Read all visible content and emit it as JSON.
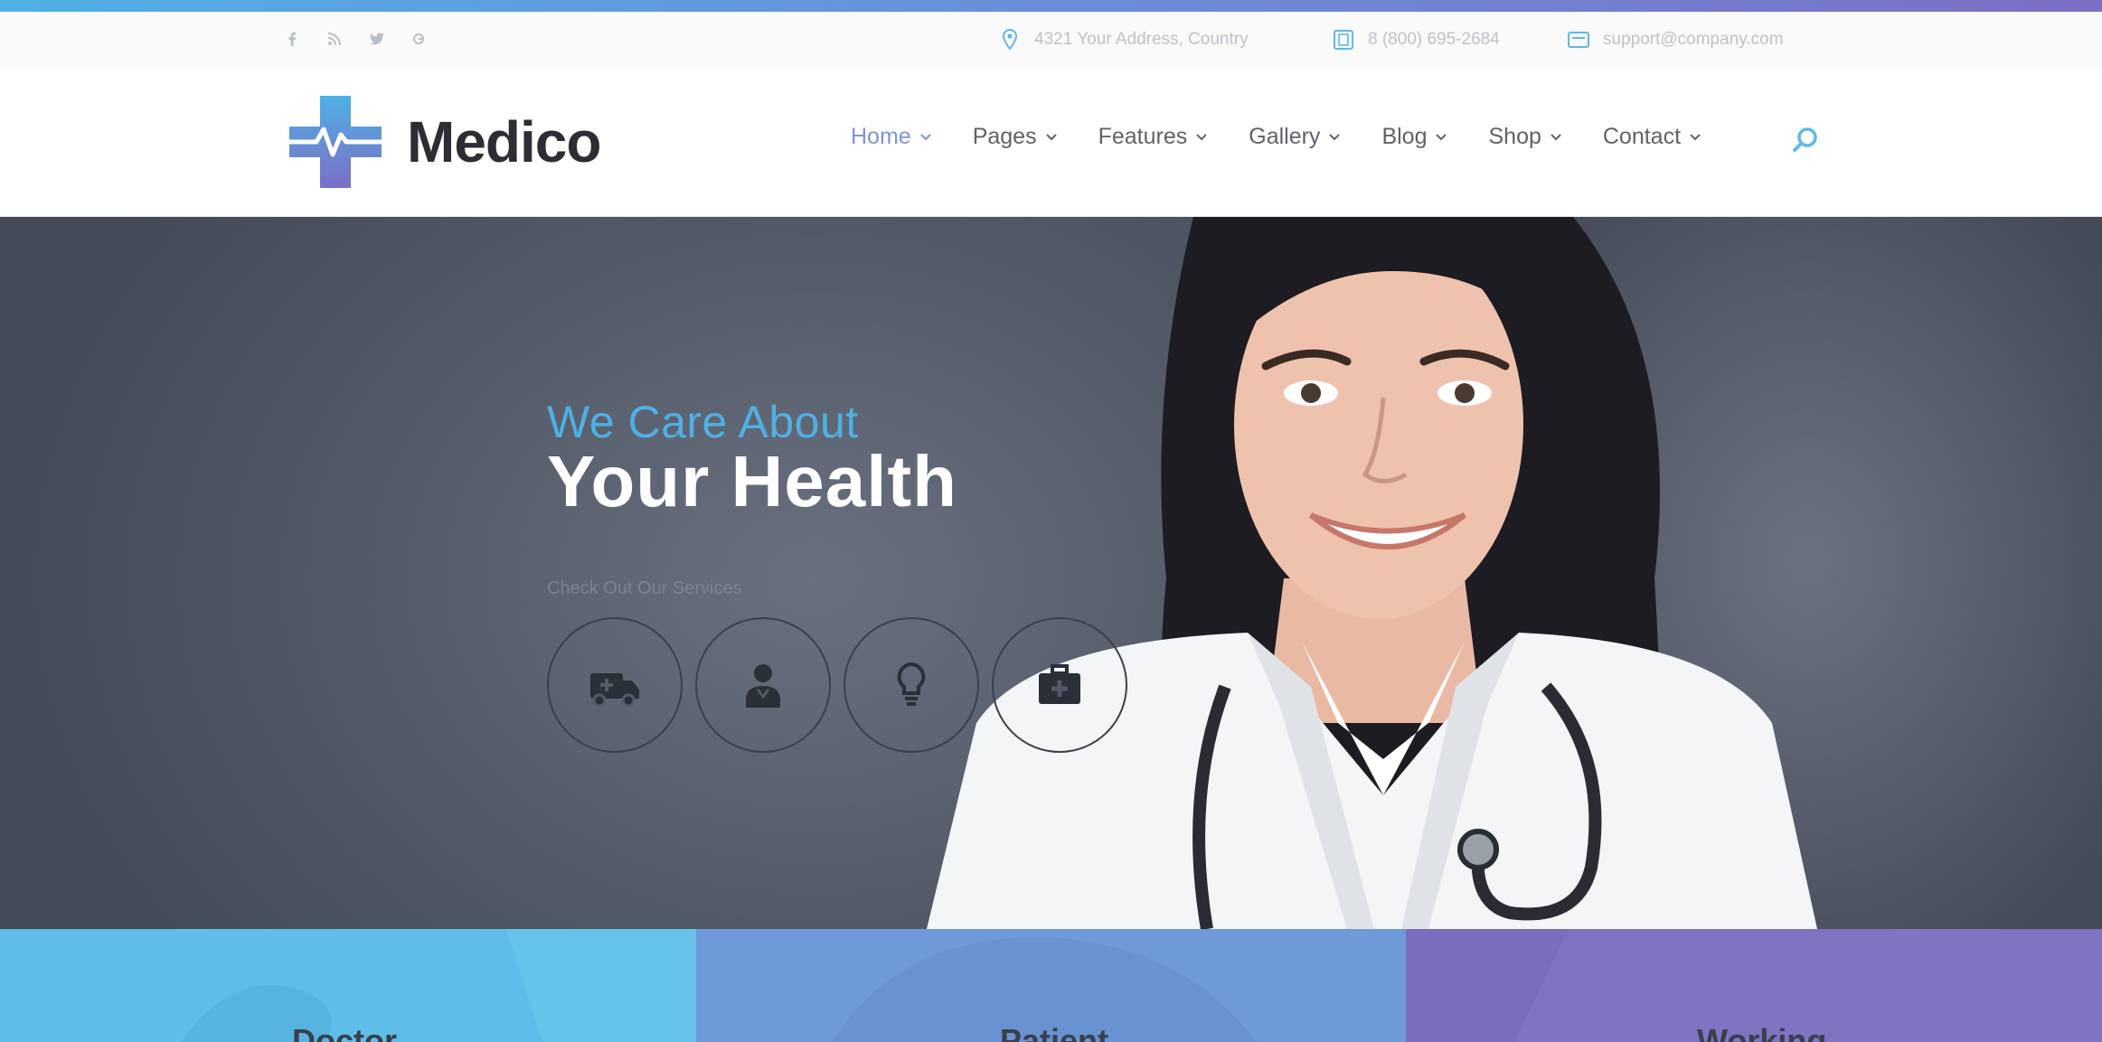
{
  "utility_bar": {
    "socials": [
      {
        "icon": "facebook-icon",
        "glyph": "f"
      },
      {
        "icon": "rss-icon",
        "glyph": "rss"
      },
      {
        "icon": "twitter-icon",
        "glyph": "tw"
      },
      {
        "icon": "google-plus-icon",
        "glyph": "g+"
      }
    ],
    "address": "4321 Your Address, Country",
    "phone": "8 (800) 695-2684",
    "email": "support@company.com"
  },
  "header": {
    "logo_text": "Medico",
    "nav": [
      "Home",
      "Pages",
      "Features",
      "Gallery",
      "Blog",
      "Shop",
      "Contact"
    ],
    "active_nav": "Home"
  },
  "hero": {
    "eyebrow": "We Care About",
    "headline": "Your Health",
    "services_label": "Check Out Our Services",
    "service_icons": [
      "ambulance-icon",
      "doctor-icon",
      "lightbulb-icon",
      "first-aid-kit-icon"
    ]
  },
  "panels": [
    {
      "title": "Doctor",
      "color": "#5fbee9"
    },
    {
      "title": "Patient",
      "color": "#6f9ad9"
    },
    {
      "title": "Working",
      "color": "#7f73c2"
    }
  ],
  "colors": {
    "accent_blue": "#4fb0e3",
    "accent_purple": "#7b6fc6",
    "nav_active": "#7f93d8",
    "hero_bg": "#535a67"
  }
}
